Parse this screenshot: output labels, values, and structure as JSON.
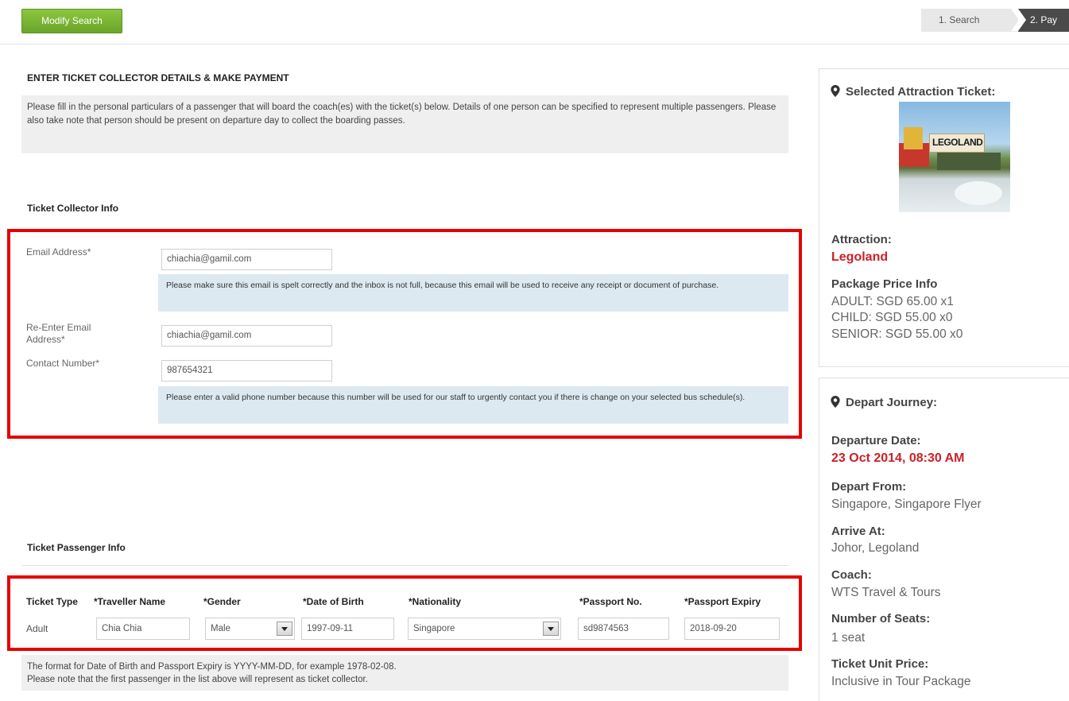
{
  "header": {
    "modify_search_label": "Modify Search",
    "steps": [
      "1. Search",
      "2. Pay"
    ]
  },
  "form": {
    "section_title": "ENTER TICKET COLLECTOR DETAILS & MAKE PAYMENT",
    "intro": "Please fill in the personal particulars of a passenger that will board the coach(es) with the ticket(s) below. Details of one person can be specified to represent multiple passengers. Please also take note that person should be present on departure day to collect the boarding passes.",
    "collector": {
      "heading": "Ticket Collector Info",
      "email_label": "Email Address*",
      "email_value": "chiachia@gamil.com",
      "email_hint": "Please make sure this email is spelt correctly and the inbox is not full, because this email will be used to receive any receipt or document of purchase.",
      "reenter_label": "Re-Enter Email Address*",
      "reenter_value": "chiachia@gamil.com",
      "contact_label": "Contact Number*",
      "contact_value": "987654321",
      "contact_hint": "Please enter a valid phone number because this number will be used for our staff to urgently contact you if there is change on your selected bus schedule(s)."
    },
    "passenger": {
      "heading": "Ticket Passenger Info",
      "columns": [
        "Ticket Type",
        "*Traveller Name",
        "*Gender",
        "*Date of Birth",
        "*Nationality",
        "*Passport No.",
        "*Passport Expiry"
      ],
      "row": {
        "ticket_type": "Adult",
        "name": "Chia Chia",
        "gender": "Male",
        "dob": "1997-09-11",
        "nationality": "Singapore",
        "passport_no": "sd9874563",
        "passport_expiry": "2018-09-20"
      },
      "note_line1": "The format for Date of Birth and Passport Expiry is YYYY-MM-DD, for example 1978-02-08.",
      "note_line2": "Please note that the first passenger in the list above will represent as ticket collector."
    }
  },
  "sidebar": {
    "attraction_panel": {
      "title": "Selected Attraction Ticket:",
      "image_sign": "LEGOLAND",
      "attraction_label": "Attraction:",
      "attraction_value": "Legoland",
      "price_label": "Package Price Info",
      "prices": [
        "ADULT: SGD 65.00 x1",
        "CHILD: SGD 55.00 x0",
        "SENIOR: SGD 55.00 x0"
      ]
    },
    "journey_panel": {
      "title": "Depart Journey:",
      "departure_date_label": "Departure Date:",
      "departure_date_value": "23 Oct 2014, 08:30 AM",
      "depart_from_label": "Depart From:",
      "depart_from_value": "Singapore, Singapore Flyer",
      "arrive_at_label": "Arrive At:",
      "arrive_at_value": "Johor, Legoland",
      "coach_label": "Coach:",
      "coach_value": "WTS Travel & Tours",
      "seats_label": "Number of Seats:",
      "seats_value": "1 seat",
      "unit_price_label": "Ticket Unit Price:",
      "unit_price_value": "Inclusive in Tour Package"
    }
  },
  "colors": {
    "accent_green": "#7ab535",
    "highlight_red": "#e60000",
    "value_red": "#cc2027",
    "hint_blue": "#dde9f1"
  }
}
